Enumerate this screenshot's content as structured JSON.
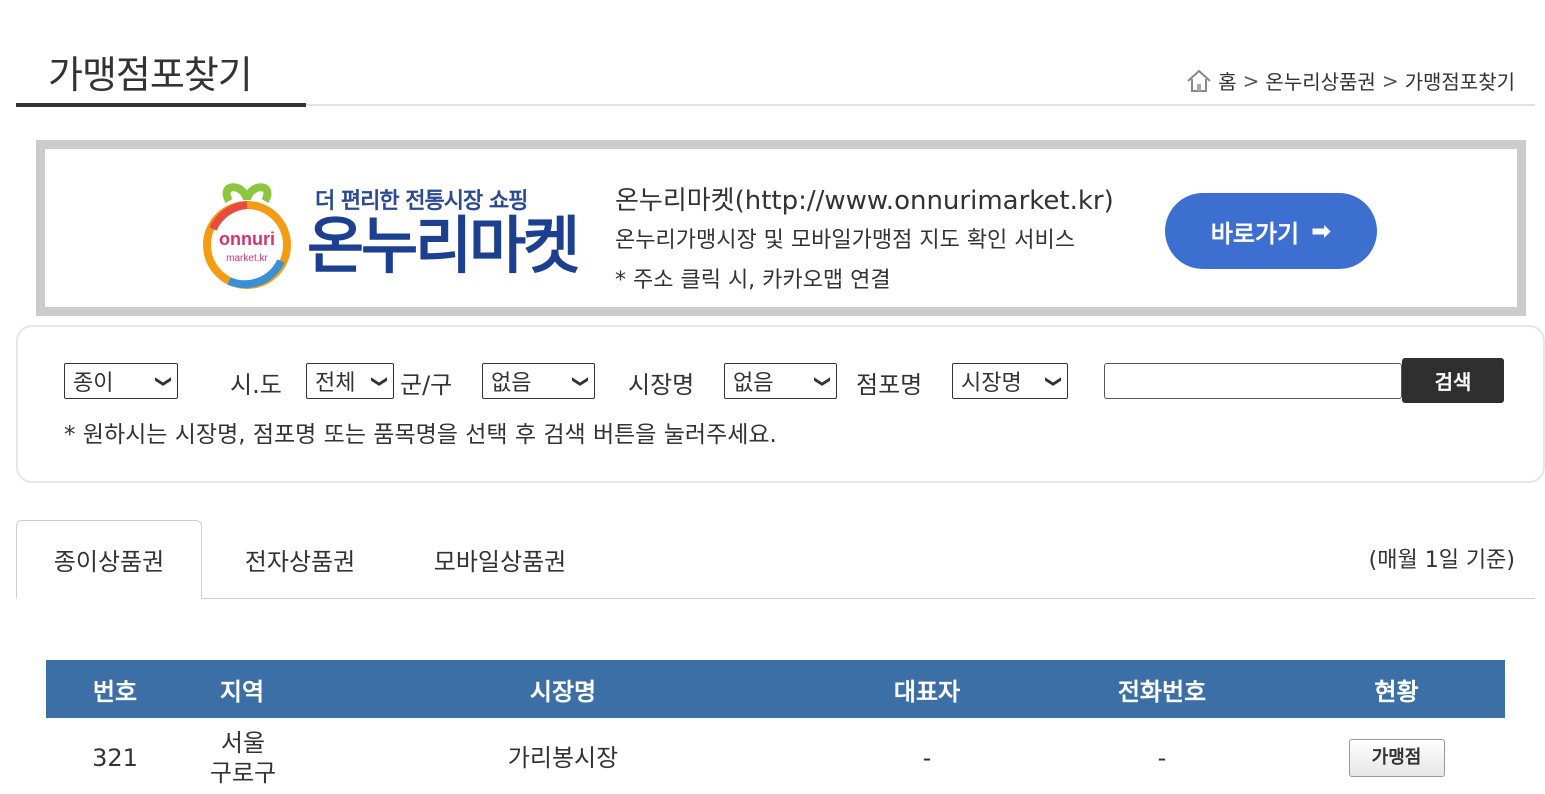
{
  "page": {
    "title": "가맹점포찾기",
    "breadcrumb": [
      "홈",
      "온누리상품권",
      "가맹점포찾기"
    ],
    "breadcrumb_sep": ">"
  },
  "banner": {
    "tagline": "더 편리한 전통시장 쇼핑",
    "brand": "온누리마켓",
    "logo_text_1": "onnuri",
    "logo_text_2": "market.kr",
    "line1": "온누리마켓(http://www.onnurimarket.kr)",
    "line2": "온누리가맹시장 및 모바일가맹점 지도 확인 서비스",
    "line3": "* 주소 클릭 시, 카카오맵 연결",
    "button_label": "바로가기",
    "button_arrow": "➡"
  },
  "search": {
    "type_value": "종이",
    "sido_label": "시.도",
    "sido_value": "전체",
    "gungu_label": "군/구",
    "gungu_value": "없음",
    "market_label": "시장명",
    "market_value": "없음",
    "store_label": "점포명",
    "store_value": "시장명",
    "keyword_value": "",
    "button_label": "검색",
    "note": "* 원하시는 시장명, 점포명 또는 품목명을 선택 후 검색 버튼을 눌러주세요."
  },
  "tabs": {
    "items": [
      {
        "label": "종이상품권",
        "active": true
      },
      {
        "label": "전자상품권",
        "active": false
      },
      {
        "label": "모바일상품권",
        "active": false
      }
    ],
    "note": "(매월 1일 기준)"
  },
  "table": {
    "headers": [
      "번호",
      "지역",
      "시장명",
      "대표자",
      "전화번호",
      "현황"
    ],
    "rows": [
      {
        "no": "321",
        "region": "서울 구로구",
        "market": "가리봉시장",
        "owner": "-",
        "phone": "-",
        "status": "가맹점"
      }
    ]
  },
  "colors": {
    "header_bg": "#3b6fa6",
    "banner_button": "#3d6fd1",
    "brand_blue": "#1d3f8f",
    "search_button": "#2f2f2f"
  }
}
